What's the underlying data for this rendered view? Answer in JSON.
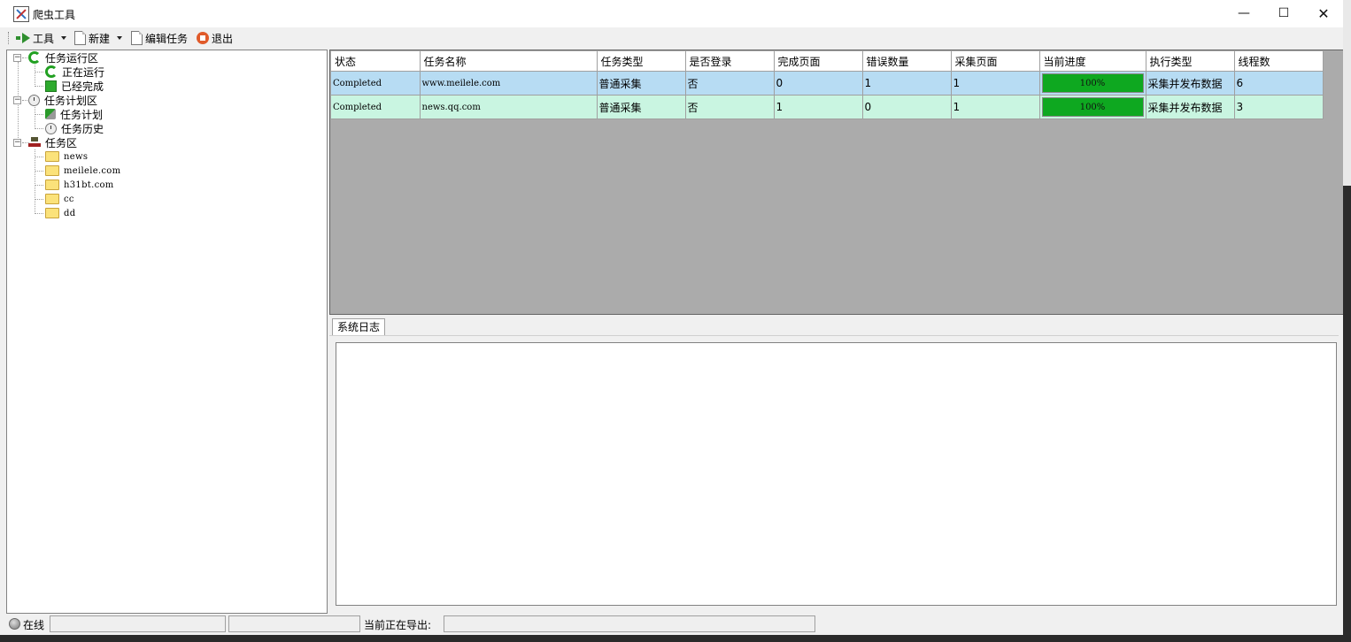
{
  "window": {
    "title": "爬虫工具"
  },
  "toolbar": {
    "tools": "工具",
    "new": "新建",
    "edit_task": "编辑任务",
    "exit": "退出"
  },
  "tree": {
    "running_zone": "任务运行区",
    "running": "正在运行",
    "completed": "已经完成",
    "plan_zone": "任务计划区",
    "plan": "任务计划",
    "history": "任务历史",
    "task_zone": "任务区",
    "folders": [
      "news",
      "meilele.com",
      "h31bt.com",
      "cc",
      "dd"
    ]
  },
  "grid": {
    "columns": [
      "状态",
      "任务名称",
      "任务类型",
      "是否登录",
      "完成页面",
      "错误数量",
      "采集页面",
      "当前进度",
      "执行类型",
      "线程数"
    ],
    "rows": [
      {
        "status": "Completed",
        "name": "www.meilele.com",
        "type": "普通采集",
        "login": "否",
        "done_pages": "0",
        "errors": "1",
        "collect_pages": "1",
        "progress": "100%",
        "progress_value": 1.0,
        "exec_type": "采集并发布数据",
        "threads": "6",
        "bg": "#b7dcf3"
      },
      {
        "status": "Completed",
        "name": "news.qq.com",
        "type": "普通采集",
        "login": "否",
        "done_pages": "1",
        "errors": "0",
        "collect_pages": "1",
        "progress": "100%",
        "progress_value": 1.0,
        "exec_type": "采集并发布数据",
        "threads": "3",
        "bg": "#c9f5e1"
      }
    ]
  },
  "log": {
    "tab_label": "系统日志",
    "content": ""
  },
  "status": {
    "online": "在线",
    "export_label": "当前正在导出:"
  },
  "colors": {
    "progress": "#0ea820",
    "row1": "#b7dcf3",
    "row2": "#c9f5e1"
  },
  "icons": [
    "app-icon",
    "arrow-right-icon",
    "document-icon",
    "stop-icon",
    "refresh-icon",
    "check-icon",
    "clock-icon",
    "plan-icon",
    "network-icon",
    "folder-icon"
  ]
}
